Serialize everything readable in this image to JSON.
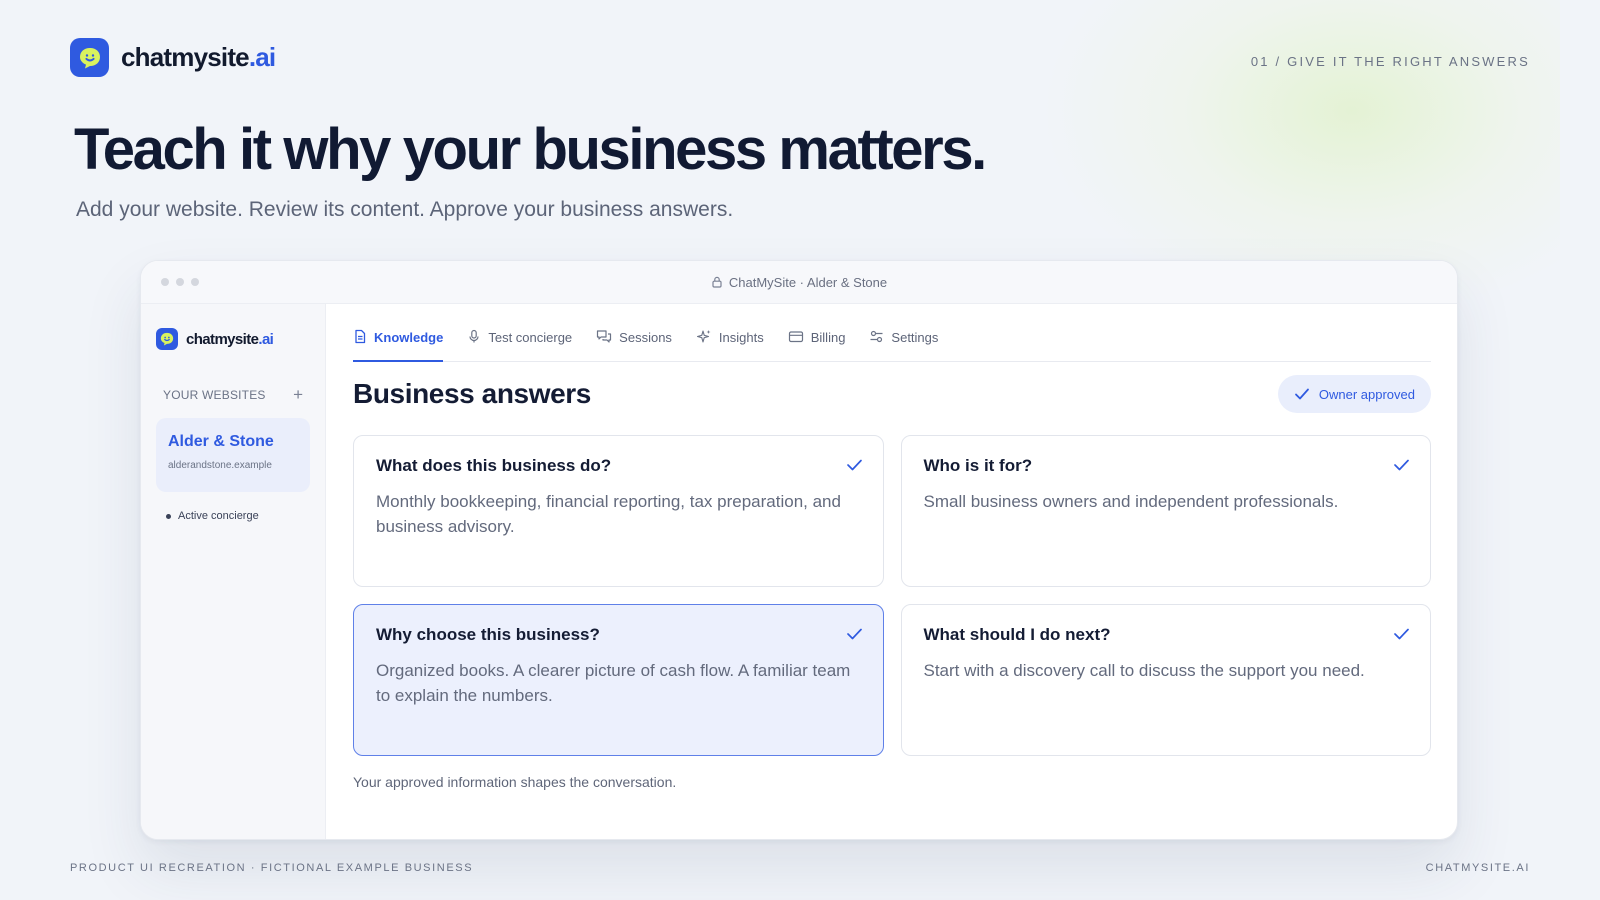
{
  "brand": {
    "name_main": "chatmysite",
    "name_accent": ".ai",
    "icon": "chat-bubble-smile-icon",
    "accent_color": "#2f5ae0"
  },
  "eyebrow": "01 / GIVE IT THE RIGHT ANSWERS",
  "headline": "Teach it why your business matters.",
  "subhead": "Add your website. Review its content. Approve your business answers.",
  "window": {
    "title": "ChatMySite · Alder & Stone",
    "title_icon": "lock-icon"
  },
  "sidebar": {
    "brand_main": "chatmysite",
    "brand_accent": ".ai",
    "section_label": "YOUR WEBSITES",
    "add_icon": "plus-icon",
    "site": {
      "name": "Alder & Stone",
      "domain": "alderandstone.example"
    },
    "status": "Active concierge"
  },
  "tabs": [
    {
      "label": "Knowledge",
      "icon": "document-icon",
      "active": true
    },
    {
      "label": "Test concierge",
      "icon": "microphone-icon",
      "active": false
    },
    {
      "label": "Sessions",
      "icon": "chat-bubbles-icon",
      "active": false
    },
    {
      "label": "Insights",
      "icon": "sparkles-icon",
      "active": false
    },
    {
      "label": "Billing",
      "icon": "credit-card-icon",
      "active": false
    },
    {
      "label": "Settings",
      "icon": "sliders-icon",
      "active": false
    }
  ],
  "main": {
    "title": "Business answers",
    "badge": "Owner approved",
    "cards": [
      {
        "question": "What does this business do?",
        "answer": "Monthly bookkeeping, financial reporting, tax preparation, and business advisory.",
        "selected": false
      },
      {
        "question": "Who is it for?",
        "answer": "Small business owners and independent professionals.",
        "selected": false
      },
      {
        "question": "Why choose this business?",
        "answer": "Organized books. A clearer picture of cash flow. A familiar team to explain the numbers.",
        "selected": true
      },
      {
        "question": "What should I do next?",
        "answer": "Start with a discovery call to discuss the support you need.",
        "selected": false
      }
    ],
    "footnote": "Your approved information shapes the conversation."
  },
  "footer": {
    "left": "PRODUCT UI RECREATION · FICTIONAL EXAMPLE BUSINESS",
    "right": "CHATMYSITE.AI"
  }
}
